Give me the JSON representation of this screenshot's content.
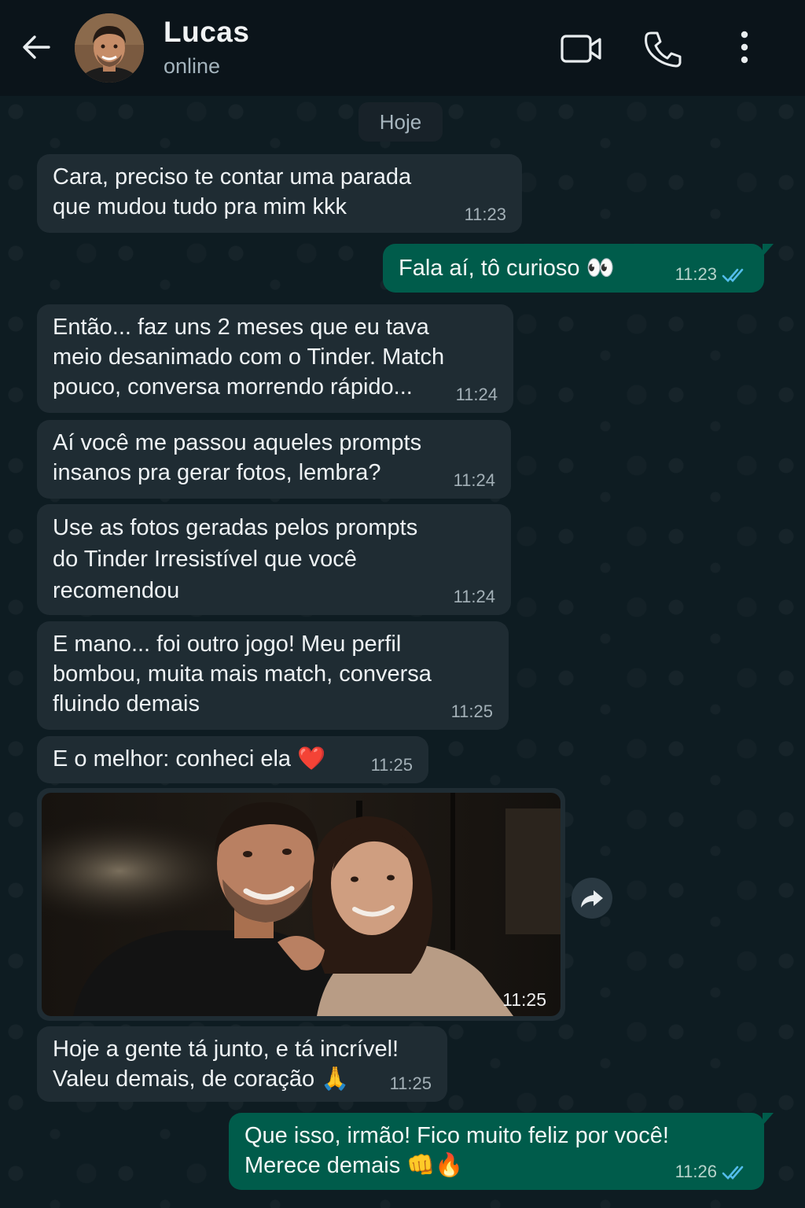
{
  "header": {
    "contact_name": "Lucas",
    "status": "online",
    "icons": [
      "back-arrow-icon",
      "video-call-icon",
      "voice-call-icon",
      "more-options-icon"
    ]
  },
  "date_chip": "Hoje",
  "messages": [
    {
      "dir": "in",
      "lines": [
        "Cara, preciso te contar uma parada",
        "que mudou tudo pra mim kkk"
      ],
      "time": "11:23"
    },
    {
      "dir": "out",
      "lines": [
        "Fala aí, tô curioso 👀"
      ],
      "time": "11:23",
      "status": "read"
    },
    {
      "dir": "in",
      "lines": [
        "Então... faz uns 2 meses que eu tava",
        "meio desanimado com o Tinder. Match",
        "pouco, conversa morrendo rápido..."
      ],
      "time": "11:24"
    },
    {
      "dir": "in",
      "lines": [
        "Aí você me passou aqueles prompts",
        "insanos pra gerar fotos, lembra?"
      ],
      "time": "11:24"
    },
    {
      "dir": "in",
      "lines": [
        "Use as fotos geradas pelos prompts",
        "do Tinder Irresistível que você",
        "recomendou"
      ],
      "time": "11:24"
    },
    {
      "dir": "in",
      "lines": [
        "E mano... foi outro jogo! Meu perfil",
        "bombou, muita mais match, conversa",
        "fluindo demais"
      ],
      "time": "11:25"
    },
    {
      "dir": "in",
      "lines": [
        "E o melhor: conheci ela ❤️"
      ],
      "time": "11:25"
    },
    {
      "dir": "in",
      "type": "photo",
      "time": "11:25"
    },
    {
      "dir": "in",
      "lines": [
        "Hoje a gente tá junto, e tá incrível!",
        "Valeu demais, de coração 🙏"
      ],
      "time": "11:25"
    },
    {
      "dir": "out",
      "lines": [
        "Que isso, irmão! Fico muito feliz por você!",
        "Merece demais 👊🔥"
      ],
      "time": "11:26",
      "status": "read"
    }
  ],
  "colors": {
    "incoming_bubble": "#1f2c33",
    "outgoing_bubble": "#005c4b",
    "read_ticks": "#53bdeb",
    "background": "#0b141a"
  }
}
